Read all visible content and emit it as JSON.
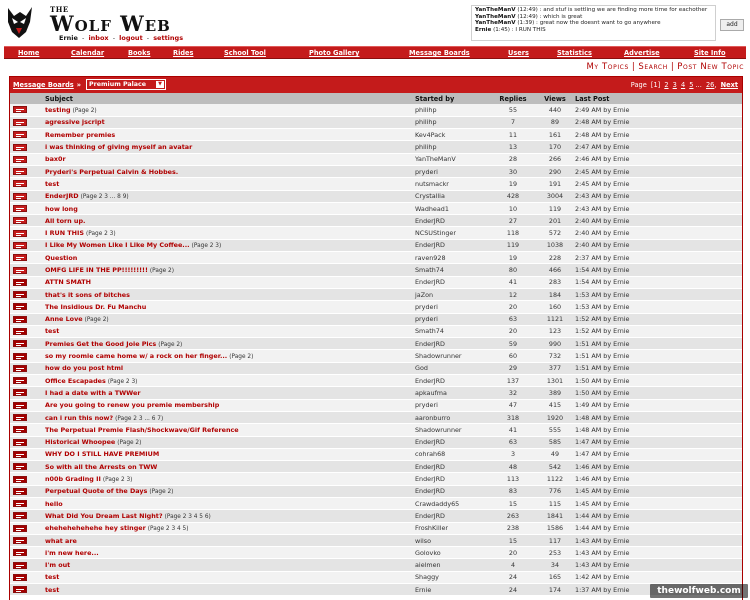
{
  "header": {
    "logo_small": "THE",
    "logo_main": "Wolf Web",
    "user": "Ernie",
    "links": [
      "inbox",
      "logout",
      "settings"
    ]
  },
  "shoutbox": {
    "lines": [
      {
        "who": "YanTheManV",
        "text": "(12:49) : and stuf is settling we are finding more time for eachother"
      },
      {
        "who": "YanTheManV",
        "text": "(12:49) : which is great"
      },
      {
        "who": "YanTheManV",
        "text": "(1:39) : great now the doesnt want to go anywhere"
      },
      {
        "who": "Ernie",
        "text": "(1:45) : I RUN THIS"
      }
    ],
    "add_label": "add"
  },
  "nav": {
    "items": [
      "Home",
      "Calendar",
      "Books",
      "Rides",
      "School Tool",
      "Photo Gallery",
      "Message Boards",
      "Users",
      "Statistics",
      "Advertise",
      "Site Info"
    ]
  },
  "subnav": [
    "My Topics",
    "Search",
    "Post New Topic"
  ],
  "board": {
    "crumb": "Message Boards",
    "selected_board": "Premium Palace",
    "pager": {
      "label": "Page",
      "current": "[1]",
      "pages": [
        "2",
        "3",
        "4",
        "5"
      ],
      "ellipsis": "...",
      "last": "26",
      "next": "Next"
    },
    "columns": {
      "subject": "Subject",
      "started_by": "Started by",
      "replies": "Replies",
      "views": "Views",
      "last_post": "Last Post"
    },
    "topics": [
      {
        "subject": "testing",
        "pages": "(Page 2)",
        "by": "philihp",
        "replies": "55",
        "views": "440",
        "last": "2:49 AM by Ernie"
      },
      {
        "subject": "agressive jscript",
        "pages": "",
        "by": "philihp",
        "replies": "7",
        "views": "89",
        "last": "2:48 AM by Ernie"
      },
      {
        "subject": "Remember premies",
        "pages": "",
        "by": "Kev4Pack",
        "replies": "11",
        "views": "161",
        "last": "2:48 AM by Ernie"
      },
      {
        "subject": "i was thinking of giving myself an avatar",
        "pages": "",
        "by": "philihp",
        "replies": "13",
        "views": "170",
        "last": "2:47 AM by Ernie"
      },
      {
        "subject": "bax0r",
        "pages": "",
        "by": "YanTheManV",
        "replies": "28",
        "views": "266",
        "last": "2:46 AM by Ernie"
      },
      {
        "subject": "Pryderi's Perpetual Calvin & Hobbes.",
        "pages": "",
        "by": "pryderi",
        "replies": "30",
        "views": "290",
        "last": "2:45 AM by Ernie"
      },
      {
        "subject": "test",
        "pages": "",
        "by": "nutsmackr",
        "replies": "19",
        "views": "191",
        "last": "2:45 AM by Ernie"
      },
      {
        "subject": "EnderJRD",
        "pages": "(Page 2 3 ... 8 9)",
        "by": "Crystallia",
        "replies": "428",
        "views": "3004",
        "last": "2:43 AM by Ernie"
      },
      {
        "subject": "how long",
        "pages": "",
        "by": "Wadhead1",
        "replies": "10",
        "views": "119",
        "last": "2:43 AM by Ernie"
      },
      {
        "subject": "All torn up.",
        "pages": "",
        "by": "EnderJRD",
        "replies": "27",
        "views": "201",
        "last": "2:40 AM by Ernie"
      },
      {
        "subject": "I RUN THIS",
        "pages": "(Page 2 3)",
        "by": "NCSUStinger",
        "replies": "118",
        "views": "572",
        "last": "2:40 AM by Ernie"
      },
      {
        "subject": "I Like My Women Like I Like My Coffee...",
        "pages": "(Page 2 3)",
        "by": "EnderJRD",
        "replies": "119",
        "views": "1038",
        "last": "2:40 AM by Ernie"
      },
      {
        "subject": "Question",
        "pages": "",
        "by": "raven928",
        "replies": "19",
        "views": "228",
        "last": "2:37 AM by Ernie"
      },
      {
        "subject": "OMFG LIFE IN THE PP!!!!!!!!!",
        "pages": "(Page 2)",
        "by": "Smath74",
        "replies": "80",
        "views": "466",
        "last": "1:54 AM by Ernie"
      },
      {
        "subject": "ATTN SMATH",
        "pages": "",
        "by": "EnderJRD",
        "replies": "41",
        "views": "283",
        "last": "1:54 AM by Ernie"
      },
      {
        "subject": "that's it sons of bitches",
        "pages": "",
        "by": "jaZon",
        "replies": "12",
        "views": "184",
        "last": "1:53 AM by Ernie"
      },
      {
        "subject": "The Insidious Dr. Fu Manchu",
        "pages": "",
        "by": "pryderi",
        "replies": "20",
        "views": "160",
        "last": "1:53 AM by Ernie"
      },
      {
        "subject": "Anne Love",
        "pages": "(Page 2)",
        "by": "pryderi",
        "replies": "63",
        "views": "1121",
        "last": "1:52 AM by Ernie"
      },
      {
        "subject": "test",
        "pages": "",
        "by": "Smath74",
        "replies": "20",
        "views": "123",
        "last": "1:52 AM by Ernie"
      },
      {
        "subject": "Premies Get the Good Joie Pics",
        "pages": "(Page 2)",
        "by": "EnderJRD",
        "replies": "59",
        "views": "990",
        "last": "1:51 AM by Ernie"
      },
      {
        "subject": "so my roomie came home w/ a rock on her finger...",
        "pages": "(Page 2)",
        "by": "Shadowrunner",
        "replies": "60",
        "views": "732",
        "last": "1:51 AM by Ernie"
      },
      {
        "subject": "how do you post html",
        "pages": "",
        "by": "God",
        "replies": "29",
        "views": "377",
        "last": "1:51 AM by Ernie"
      },
      {
        "subject": "Office Escapades",
        "pages": "(Page 2 3)",
        "by": "EnderJRD",
        "replies": "137",
        "views": "1301",
        "last": "1:50 AM by Ernie"
      },
      {
        "subject": "I had a date with a TWWer",
        "pages": "",
        "by": "apkaufma",
        "replies": "32",
        "views": "389",
        "last": "1:50 AM by Ernie"
      },
      {
        "subject": "Are you going to renew you premie membership",
        "pages": "",
        "by": "pryderi",
        "replies": "47",
        "views": "415",
        "last": "1:49 AM by Ernie"
      },
      {
        "subject": "can i run this now?",
        "pages": "(Page 2 3 ... 6 7)",
        "by": "aaronburro",
        "replies": "318",
        "views": "1920",
        "last": "1:48 AM by Ernie"
      },
      {
        "subject": "The Perpetual Premie Flash/Shockwave/Gif Reference",
        "pages": "",
        "by": "Shadowrunner",
        "replies": "41",
        "views": "555",
        "last": "1:48 AM by Ernie"
      },
      {
        "subject": "Historical Whoopee",
        "pages": "(Page 2)",
        "by": "EnderJRD",
        "replies": "63",
        "views": "585",
        "last": "1:47 AM by Ernie"
      },
      {
        "subject": "WHY DO I STILL HAVE PREMIUM",
        "pages": "",
        "by": "cohrah68",
        "replies": "3",
        "views": "49",
        "last": "1:47 AM by Ernie"
      },
      {
        "subject": "So with all the Arrests on TWW",
        "pages": "",
        "by": "EnderJRD",
        "replies": "48",
        "views": "542",
        "last": "1:46 AM by Ernie"
      },
      {
        "subject": "n00b Grading II",
        "pages": "(Page 2 3)",
        "by": "EnderJRD",
        "replies": "113",
        "views": "1122",
        "last": "1:46 AM by Ernie"
      },
      {
        "subject": "Perpetual Quote of the Days",
        "pages": "(Page 2)",
        "by": "EnderJRD",
        "replies": "83",
        "views": "776",
        "last": "1:45 AM by Ernie"
      },
      {
        "subject": "hello",
        "pages": "",
        "by": "Crawdaddy65",
        "replies": "15",
        "views": "115",
        "last": "1:45 AM by Ernie"
      },
      {
        "subject": "What Did You Dream Last Night?",
        "pages": "(Page 2 3 4 5 6)",
        "by": "EnderJRD",
        "replies": "263",
        "views": "1841",
        "last": "1:44 AM by Ernie"
      },
      {
        "subject": "ehehehehehehe hey stinger",
        "pages": "(Page 2 3 4 5)",
        "by": "FroshKiller",
        "replies": "238",
        "views": "1586",
        "last": "1:44 AM by Ernie"
      },
      {
        "subject": "what are",
        "pages": "",
        "by": "wilso",
        "replies": "15",
        "views": "117",
        "last": "1:43 AM by Ernie"
      },
      {
        "subject": "i'm new here...",
        "pages": "",
        "by": "Golovko",
        "replies": "20",
        "views": "253",
        "last": "1:43 AM by Ernie"
      },
      {
        "subject": "I'm out",
        "pages": "",
        "by": "aielmen",
        "replies": "4",
        "views": "34",
        "last": "1:43 AM by Ernie"
      },
      {
        "subject": "test",
        "pages": "",
        "by": "Shaggy",
        "replies": "24",
        "views": "165",
        "last": "1:42 AM by Ernie"
      },
      {
        "subject": "test",
        "pages": "",
        "by": "Ernie",
        "replies": "24",
        "views": "174",
        "last": "1:37 AM by Ernie"
      }
    ]
  },
  "watermark": "thewolfweb.com"
}
